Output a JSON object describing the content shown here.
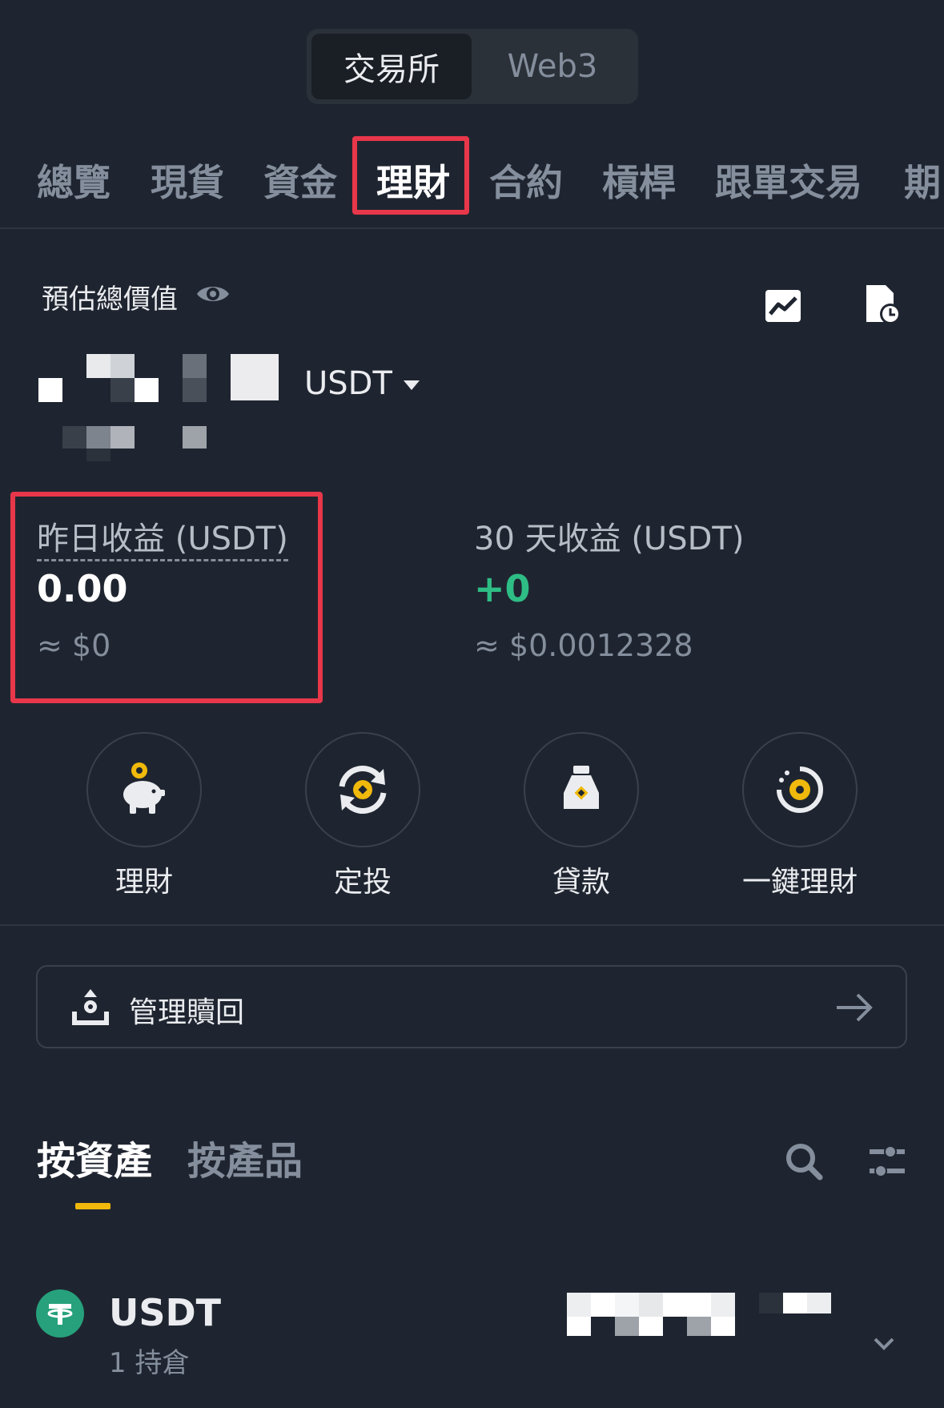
{
  "top_switch": {
    "active": "交易所",
    "inactive": "Web3"
  },
  "category_tabs": [
    "總覽",
    "現貨",
    "資金",
    "理財",
    "合約",
    "槓桿",
    "跟單交易",
    "期"
  ],
  "category_active": "理財",
  "estimate": {
    "label": "預估總價值",
    "currency": "USDT"
  },
  "earnings": {
    "yesterday_label": "昨日收益 (USDT)",
    "yesterday_value": "0.00",
    "yesterday_usd": "≈ $0",
    "thirty_label": "30 天收益 (USDT)",
    "thirty_value": "+0",
    "thirty_usd": "≈ $0.0012328"
  },
  "quick_actions": [
    "理財",
    "定投",
    "貸款",
    "一鍵理財"
  ],
  "redeem": {
    "label": "管理贖回"
  },
  "asset_tabs": {
    "active": "按資產",
    "inactive": "按產品"
  },
  "asset": {
    "name": "USDT",
    "positions": "1 持倉"
  },
  "colors": {
    "background": "#1f2530",
    "highlight": "#e8374a",
    "accent": "#f0b90b",
    "positive": "#2ebd85",
    "coin": "#26a17b"
  }
}
